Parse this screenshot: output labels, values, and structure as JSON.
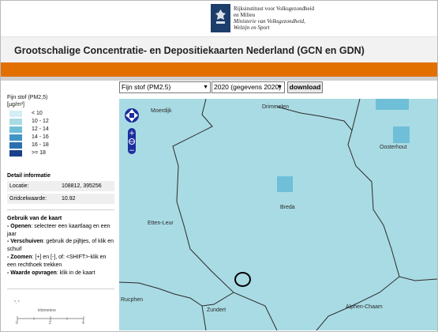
{
  "header": {
    "org_line1": "Rijksinstituut voor Volksgezondheid",
    "org_line2": "en Milieu",
    "ministry_line1": "Ministerie van Volksgezondheid,",
    "ministry_line2": "Welzijn en Sport",
    "title": "Grootschalige Concentratie- en Depositiekaarten Nederland (GCN en GDN)"
  },
  "toolbar": {
    "component_value": "Fijn stof (PM2.5)",
    "year_value": "2020 (gegevens 2020)",
    "download_label": "download"
  },
  "legend": {
    "title_line1": "Fijn stof (PM2,5)",
    "title_line2": "[µg/m³]",
    "items": [
      {
        "label": "< 10",
        "color": "#d5eef3"
      },
      {
        "label": "10 - 12",
        "color": "#a9dbe4"
      },
      {
        "label": "12 - 14",
        "color": "#6fbfd8"
      },
      {
        "label": "14 - 16",
        "color": "#3f95c6"
      },
      {
        "label": "16 - 18",
        "color": "#2a6fb0"
      },
      {
        "label": ">= 18",
        "color": "#1b3f8a"
      }
    ]
  },
  "detail": {
    "heading": "Detail informatie",
    "location_label": "Locatie:",
    "location_value": "108812, 395256",
    "gridcell_label": "Gridcelwaarde:",
    "gridcell_value": "10.92"
  },
  "usage": {
    "heading": "Gebruik van de kaart",
    "open_key": "- Openen",
    "open_text": ": selecteer een kaartlaag en een jaar",
    "move_key": "- Verschuiven",
    "move_text": ": gebruik de pijltjes, of klik en schuif",
    "zoom_key": "- Zoomen",
    "zoom_text": ": [+] en [-], of: <SHIFT>-klik en een rechthoek trekken",
    "value_key": "- Waarde opvragen",
    "value_text": ": klik in de kaart"
  },
  "scale": {
    "unit": "kilometers",
    "ticks": [
      "0",
      "2",
      "4"
    ]
  },
  "map": {
    "places": [
      "Moerdijk",
      "Drimmelen",
      "Oosterhout",
      "Breda",
      "Etten-Leur",
      "Rucphen",
      "Zundert",
      "Alphen-Chaam"
    ]
  }
}
